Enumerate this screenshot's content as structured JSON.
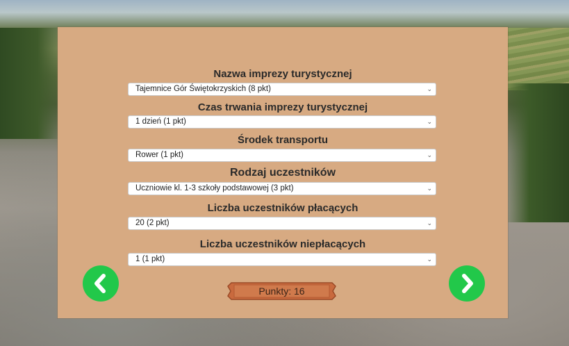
{
  "fields": [
    {
      "title": "Nazwa imprezy turystycznej",
      "value": "Tajemnice Gór Świętokrzyskich (8 pkt)"
    },
    {
      "title": "Czas trwania imprezy turystycznej",
      "value": "1 dzień (1 pkt)"
    },
    {
      "title": "Środek transportu",
      "value": "Rower (1 pkt)"
    },
    {
      "title": "Rodzaj uczestników",
      "value": "Uczniowie kl. 1-3 szkoły podstawowej (3 pkt)"
    },
    {
      "title": "Liczba uczestników płacących",
      "value": "20 (2 pkt)"
    },
    {
      "title": "Liczba uczestników niepłacących",
      "value": "1 (1 pkt)"
    }
  ],
  "score": {
    "label": "Punkty: 16"
  },
  "nav": {
    "prev_icon": "chevron-left-icon",
    "next_icon": "chevron-right-icon"
  },
  "colors": {
    "panel": "#d7aa82",
    "nav_button": "#22c84a",
    "score_plate": "#c96a3e"
  }
}
